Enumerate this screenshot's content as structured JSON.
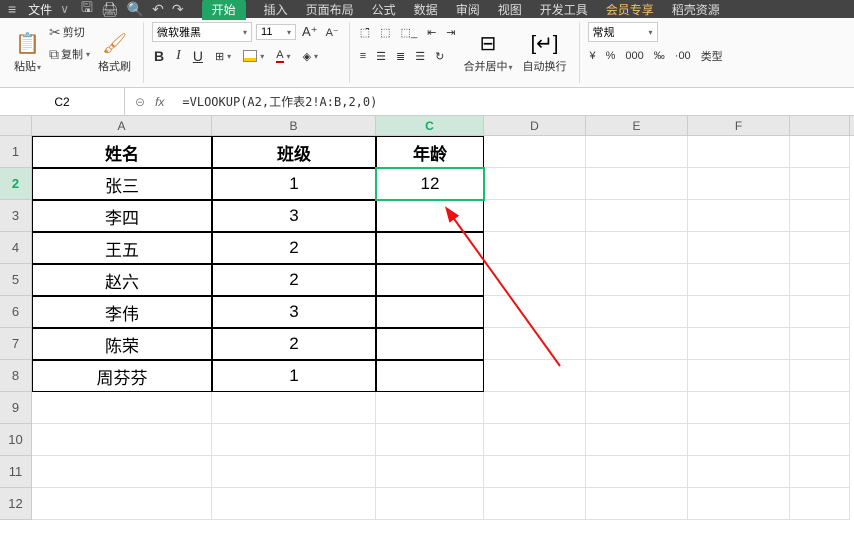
{
  "tabs": {
    "file": "文件",
    "items": [
      "开始",
      "插入",
      "页面布局",
      "公式",
      "数据",
      "审阅",
      "视图",
      "开发工具",
      "会员专享",
      "稻壳资源"
    ],
    "active_index": 0
  },
  "ribbon": {
    "cut": "剪切",
    "copy": "复制",
    "paste": "粘贴",
    "format_painter": "格式刷",
    "font_name": "微软雅黑",
    "font_size": "11",
    "merge_center": "合并居中",
    "wrap_text": "自动换行",
    "number_format": "常规",
    "number_btns": [
      "¥",
      "%",
      "000",
      "‰",
      "·00"
    ],
    "type_label": "类型"
  },
  "formula_bar": {
    "name_box": "C2",
    "formula": "=VLOOKUP(A2,工作表2!A:B,2,0)"
  },
  "columns": [
    "A",
    "B",
    "C",
    "D",
    "E",
    "F"
  ],
  "chart_data": {
    "type": "table",
    "selected_cell": "C2",
    "headers": [
      "姓名",
      "班级",
      "年龄"
    ],
    "rows": [
      {
        "name": "张三",
        "class": "1",
        "age": "12"
      },
      {
        "name": "李四",
        "class": "3",
        "age": ""
      },
      {
        "name": "王五",
        "class": "2",
        "age": ""
      },
      {
        "name": "赵六",
        "class": "2",
        "age": ""
      },
      {
        "name": "李伟",
        "class": "3",
        "age": ""
      },
      {
        "name": "陈荣",
        "class": "2",
        "age": ""
      },
      {
        "name": "周芬芬",
        "class": "1",
        "age": ""
      }
    ]
  }
}
